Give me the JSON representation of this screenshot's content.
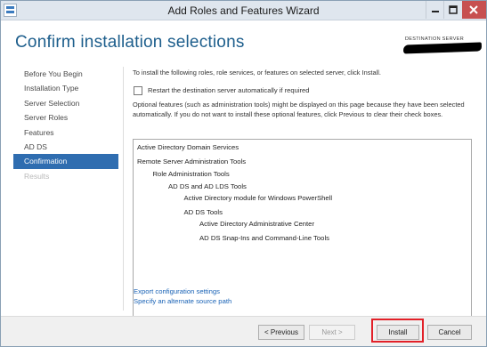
{
  "window": {
    "title": "Add Roles and Features Wizard",
    "accent_color": "#1d5e8c",
    "close_color": "#c75050"
  },
  "header": {
    "page_title": "Confirm installation selections",
    "destination_label": "DESTINATION SERVER"
  },
  "sidebar": {
    "items": [
      {
        "label": "Before You Begin",
        "state": "normal"
      },
      {
        "label": "Installation Type",
        "state": "normal"
      },
      {
        "label": "Server Selection",
        "state": "normal"
      },
      {
        "label": "Server Roles",
        "state": "normal"
      },
      {
        "label": "Features",
        "state": "normal"
      },
      {
        "label": "AD DS",
        "state": "normal"
      },
      {
        "label": "Confirmation",
        "state": "active"
      },
      {
        "label": "Results",
        "state": "disabled"
      }
    ],
    "active_color": "#2f6db0"
  },
  "main": {
    "intro": "To install the following roles, role services, or features on selected server, click Install.",
    "restart_checkbox": {
      "label": "Restart the destination server automatically if required",
      "checked": false
    },
    "optional_note": "Optional features (such as administration tools) might be displayed on this page because they have been selected automatically. If you do not want to install these optional features, click Previous to clear their check boxes.",
    "selections": [
      {
        "text": "Active Directory Domain Services",
        "level": 0
      },
      {
        "text": "Remote Server Administration Tools",
        "level": 0
      },
      {
        "text": "Role Administration Tools",
        "level": 1
      },
      {
        "text": "AD DS and AD LDS Tools",
        "level": 2
      },
      {
        "text": "Active Directory module for Windows PowerShell",
        "level": 3
      },
      {
        "text": "AD DS Tools",
        "level": 3
      },
      {
        "text": "Active Directory Administrative Center",
        "level": 4
      },
      {
        "text": "AD DS Snap-Ins and Command-Line Tools",
        "level": 4
      }
    ],
    "links": {
      "export": "Export configuration settings",
      "alternate_source": "Specify an alternate source path"
    }
  },
  "footer": {
    "previous": "< Previous",
    "next": "Next >",
    "install": "Install",
    "cancel": "Cancel",
    "highlight_color": "#e22028"
  }
}
